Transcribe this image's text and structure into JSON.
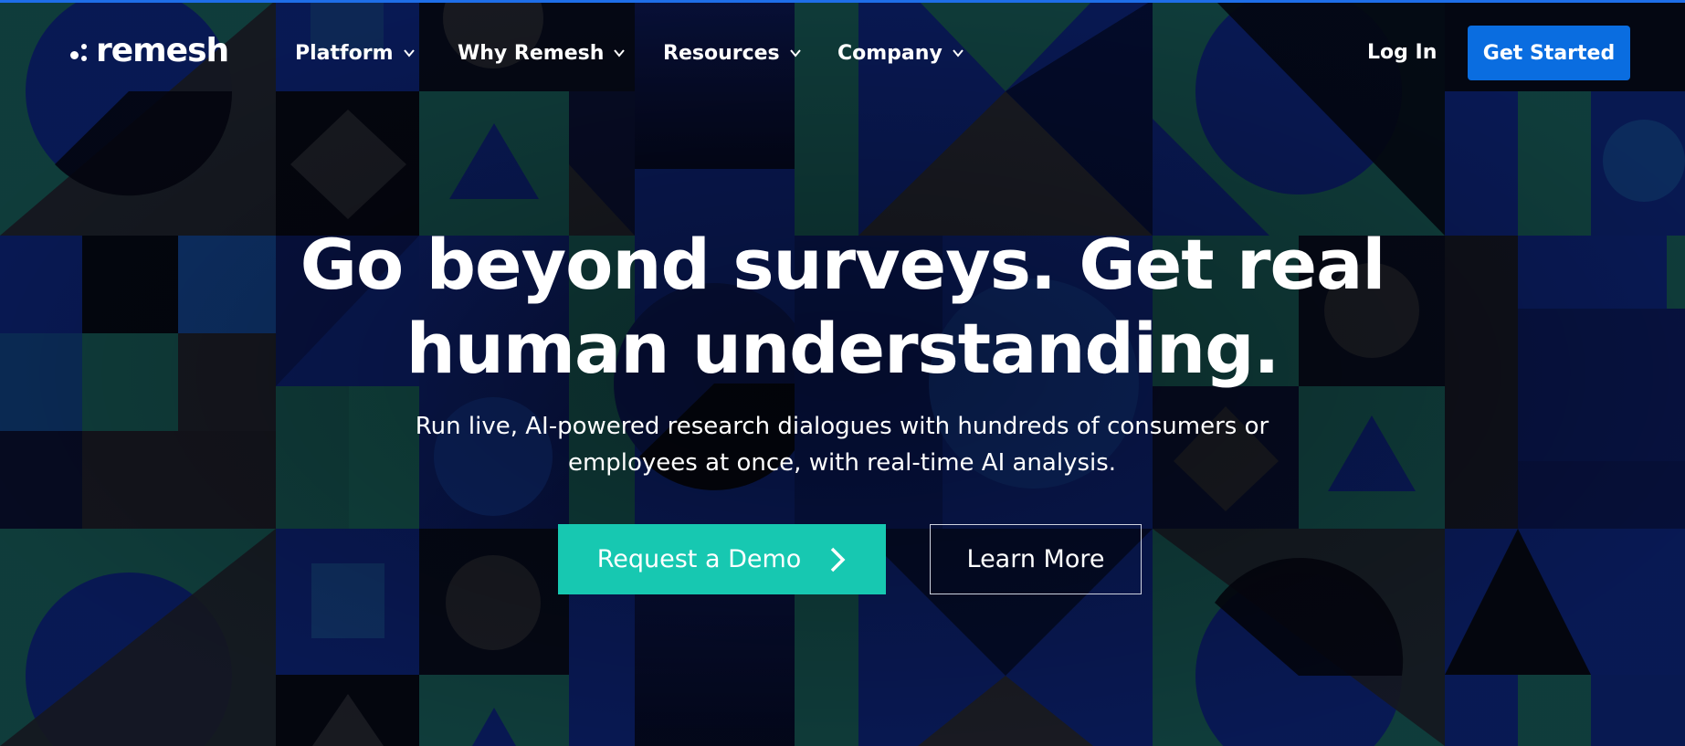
{
  "brand": {
    "name": "remesh"
  },
  "nav": {
    "items": [
      {
        "label": "Platform"
      },
      {
        "label": "Why Remesh"
      },
      {
        "label": "Resources"
      },
      {
        "label": "Company"
      }
    ],
    "login_label": "Log In",
    "cta_label": "Get Started"
  },
  "hero": {
    "title_line1": "Go beyond surveys. Get real",
    "title_line2": "human understanding.",
    "subtitle_line1": "Run live, AI-powered research dialogues with hundreds of consumers or",
    "subtitle_line2": "employees at once, with real-time AI analysis.",
    "primary_cta": "Request a Demo",
    "secondary_cta": "Learn More"
  },
  "icons": {
    "nav_chevron": "chevron-down-icon",
    "cta_arrow": "chevron-right-icon"
  },
  "colors": {
    "accent_blue": "#0a6de0",
    "demo_teal": "#17c8b1",
    "background_navy": "#0b1230",
    "pattern_green": "#1b6b5e",
    "pattern_blue": "#0f2a8a"
  }
}
